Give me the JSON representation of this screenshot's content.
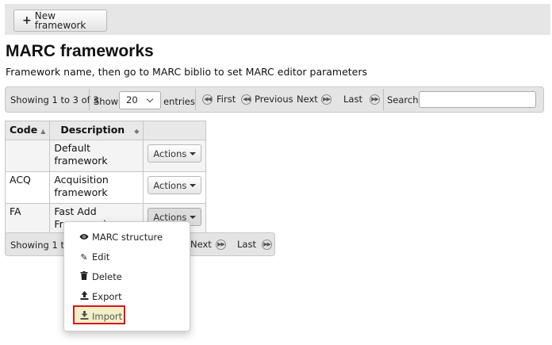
{
  "toolbar": {
    "new_framework_label": "New framework",
    "plus_icon": "+"
  },
  "page": {
    "title": "MARC frameworks",
    "intro": "Framework name, then go to MARC biblio to set MARC editor parameters"
  },
  "pager_top": {
    "showing": "Showing 1 to 3 of 3",
    "show_label": "Show",
    "length_value": "20",
    "entries_label": "entries",
    "first": "First",
    "previous": "Previous",
    "next": "Next",
    "last": "Last",
    "search_label": "Search:",
    "search_value": ""
  },
  "table": {
    "headers": {
      "code": "Code",
      "description": "Description"
    },
    "rows": [
      {
        "code": "",
        "description_line1": "Default",
        "description_line2": "framework",
        "actions": "Actions"
      },
      {
        "code": "ACQ",
        "description_line1": "Acquisition",
        "description_line2": "framework",
        "actions": "Actions"
      },
      {
        "code": "FA",
        "description_line1": "Fast Add",
        "description_line2": "Framework",
        "actions": "Actions"
      }
    ]
  },
  "pager_bottom": {
    "showing": "Showing 1 to 3",
    "next": "Next",
    "last": "Last"
  },
  "actions_menu": {
    "items": [
      {
        "label": "MARC structure",
        "icon": "eye-icon"
      },
      {
        "label": "Edit",
        "icon": "pencil-icon"
      },
      {
        "label": "Delete",
        "icon": "trash-icon"
      },
      {
        "label": "Export",
        "icon": "upload-icon"
      },
      {
        "label": "Import",
        "icon": "download-icon"
      }
    ],
    "highlight_color": "#d71920"
  }
}
